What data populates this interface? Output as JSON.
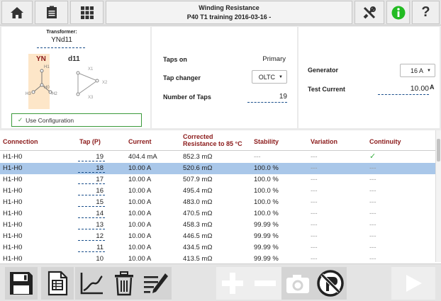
{
  "header": {
    "title": "Winding Resistance",
    "subtitle": "P40 T1 training 2016-03-16 -"
  },
  "transformer": {
    "heading": "Transformer:",
    "vector_group": "YNd11",
    "hv_label": "YN",
    "lv_label": "d11",
    "terminals": {
      "h1": "H1",
      "h2": "H2",
      "h3": "H3",
      "h0": "H0",
      "x1": "X1",
      "x2": "X2",
      "x3": "X3"
    },
    "use_config": "Use Configuration"
  },
  "taps": {
    "taps_on_label": "Taps on",
    "taps_on_value": "Primary",
    "tap_changer_label": "Tap changer",
    "tap_changer_value": "OLTC",
    "num_taps_label": "Number of Taps",
    "num_taps_value": "19"
  },
  "generator": {
    "label": "Generator",
    "value": "16 A",
    "test_current_label": "Test Current",
    "test_current_value": "10.00",
    "test_current_unit": "A"
  },
  "table": {
    "headers": {
      "connection": "Connection",
      "tap": "Tap (P)",
      "current": "Current",
      "corrected_1": "Corrected",
      "corrected_2": "Resistance to 85 °C",
      "stability": "Stability",
      "variation": "Variation",
      "continuity": "Continuity"
    },
    "rows": [
      {
        "connection": "H1-H0",
        "tap": "19",
        "current": "404.4 mA",
        "resistance": "852.3 mΩ",
        "stability": "---",
        "variation": "---",
        "continuity": "✓"
      },
      {
        "connection": "H1-H0",
        "tap": "18",
        "current": "10.00 A",
        "resistance": "520.6 mΩ",
        "stability": "100.0 %",
        "variation": "---",
        "continuity": "---"
      },
      {
        "connection": "H1-H0",
        "tap": "17",
        "current": "10.00 A",
        "resistance": "507.9 mΩ",
        "stability": "100.0 %",
        "variation": "---",
        "continuity": "---"
      },
      {
        "connection": "H1-H0",
        "tap": "16",
        "current": "10.00 A",
        "resistance": "495.4 mΩ",
        "stability": "100.0 %",
        "variation": "---",
        "continuity": "---"
      },
      {
        "connection": "H1-H0",
        "tap": "15",
        "current": "10.00 A",
        "resistance": "483.0 mΩ",
        "stability": "100.0 %",
        "variation": "---",
        "continuity": "---"
      },
      {
        "connection": "H1-H0",
        "tap": "14",
        "current": "10.00 A",
        "resistance": "470.5 mΩ",
        "stability": "100.0 %",
        "variation": "---",
        "continuity": "---"
      },
      {
        "connection": "H1-H0",
        "tap": "13",
        "current": "10.00 A",
        "resistance": "458.3 mΩ",
        "stability": "99.99 %",
        "variation": "---",
        "continuity": "---"
      },
      {
        "connection": "H1-H0",
        "tap": "12",
        "current": "10.00 A",
        "resistance": "446.5 mΩ",
        "stability": "99.99 %",
        "variation": "---",
        "continuity": "---"
      },
      {
        "connection": "H1-H0",
        "tap": "11",
        "current": "10.00 A",
        "resistance": "434.5 mΩ",
        "stability": "99.99 %",
        "variation": "---",
        "continuity": "---"
      },
      {
        "connection": "H1-H0",
        "tap": "10",
        "current": "10.00 A",
        "resistance": "413.5 mΩ",
        "stability": "99.99 %",
        "variation": "---",
        "continuity": "---"
      }
    ],
    "selected_row": 1
  },
  "colors": {
    "header_text": "#8b1a1a",
    "selected_row": "#a9c7e9",
    "info_green": "#22bb22",
    "continuity_green": "#3cb043",
    "icon_dark": "#333333",
    "icon_light": "#ffffff"
  },
  "icons": {
    "top": [
      "home-icon",
      "document-icon",
      "grid-icon",
      "tools-icon",
      "info-icon",
      "help-icon"
    ],
    "bottom": [
      "save-icon",
      "report-icon",
      "graph-icon",
      "trash-icon",
      "notes-icon",
      "add-icon",
      "remove-icon",
      "camera-icon",
      "no-signal-icon",
      "play-icon"
    ]
  }
}
